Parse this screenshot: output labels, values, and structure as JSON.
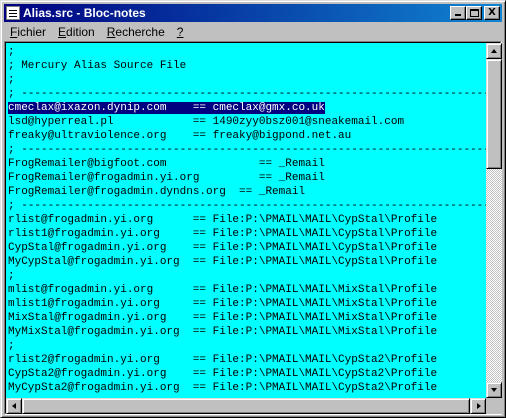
{
  "window": {
    "title": "Alias.src - Bloc-notes"
  },
  "titlebar_buttons": {
    "close_glyph": "X"
  },
  "menu": {
    "items": [
      {
        "label": "Fichier",
        "accel": "F",
        "rest": "ichier"
      },
      {
        "label": "Edition",
        "accel": "E",
        "rest": "dition"
      },
      {
        "label": "Recherche",
        "accel": "R",
        "rest": "echerche"
      },
      {
        "label": "?",
        "accel": "?",
        "rest": ""
      }
    ]
  },
  "editor": {
    "lines": [
      ";",
      "; Mercury Alias Source File",
      ";",
      "; -----------------------------------------------------------------------",
      "cmeclax@ixazon.dynip.com    == cmeclax@gmx.co.uk",
      "lsd@hyperreal.pl            == 1490zyy0bsz001@sneakemail.com",
      "freaky@ultraviolence.org    == freaky@bigpond.net.au",
      "; -----------------------------------------------------------------------",
      "FrogRemailer@bigfoot.com              == _Remail",
      "FrogRemailer@frogadmin.yi.org         == _Remail",
      "FrogRemailer@frogadmin.dyndns.org  == _Remail",
      "; -----------------------------------------------------------------------",
      "rlist@frogadmin.yi.org      == File:P:\\PMAIL\\MAIL\\CypStal\\Profile",
      "rlist1@frogadmin.yi.org     == File:P:\\PMAIL\\MAIL\\CypStal\\Profile",
      "CypStal@frogadmin.yi.org    == File:P:\\PMAIL\\MAIL\\CypStal\\Profile",
      "MyCypStal@frogadmin.yi.org  == File:P:\\PMAIL\\MAIL\\CypStal\\Profile",
      ";",
      "mlist@frogadmin.yi.org      == File:P:\\PMAIL\\MAIL\\MixStal\\Profile",
      "mlist1@frogadmin.yi.org     == File:P:\\PMAIL\\MAIL\\MixStal\\Profile",
      "MixStal@frogadmin.yi.org    == File:P:\\PMAIL\\MAIL\\MixStal\\Profile",
      "MyMixStal@frogadmin.yi.org  == File:P:\\PMAIL\\MAIL\\MixStal\\Profile",
      ";",
      "rlist2@frogadmin.yi.org     == File:P:\\PMAIL\\MAIL\\CypSta2\\Profile",
      "CypSta2@frogadmin.yi.org    == File:P:\\PMAIL\\MAIL\\CypSta2\\Profile",
      "MyCypSta2@frogadmin.yi.org  == File:P:\\PMAIL\\MAIL\\CypSta2\\Profile"
    ],
    "selected_line_index": 4,
    "background_color": "#00ffff",
    "selection_color": "#000080"
  },
  "colors": {
    "titlebar_start": "#000080",
    "titlebar_end": "#1084d0",
    "chrome": "#c0c0c0"
  }
}
